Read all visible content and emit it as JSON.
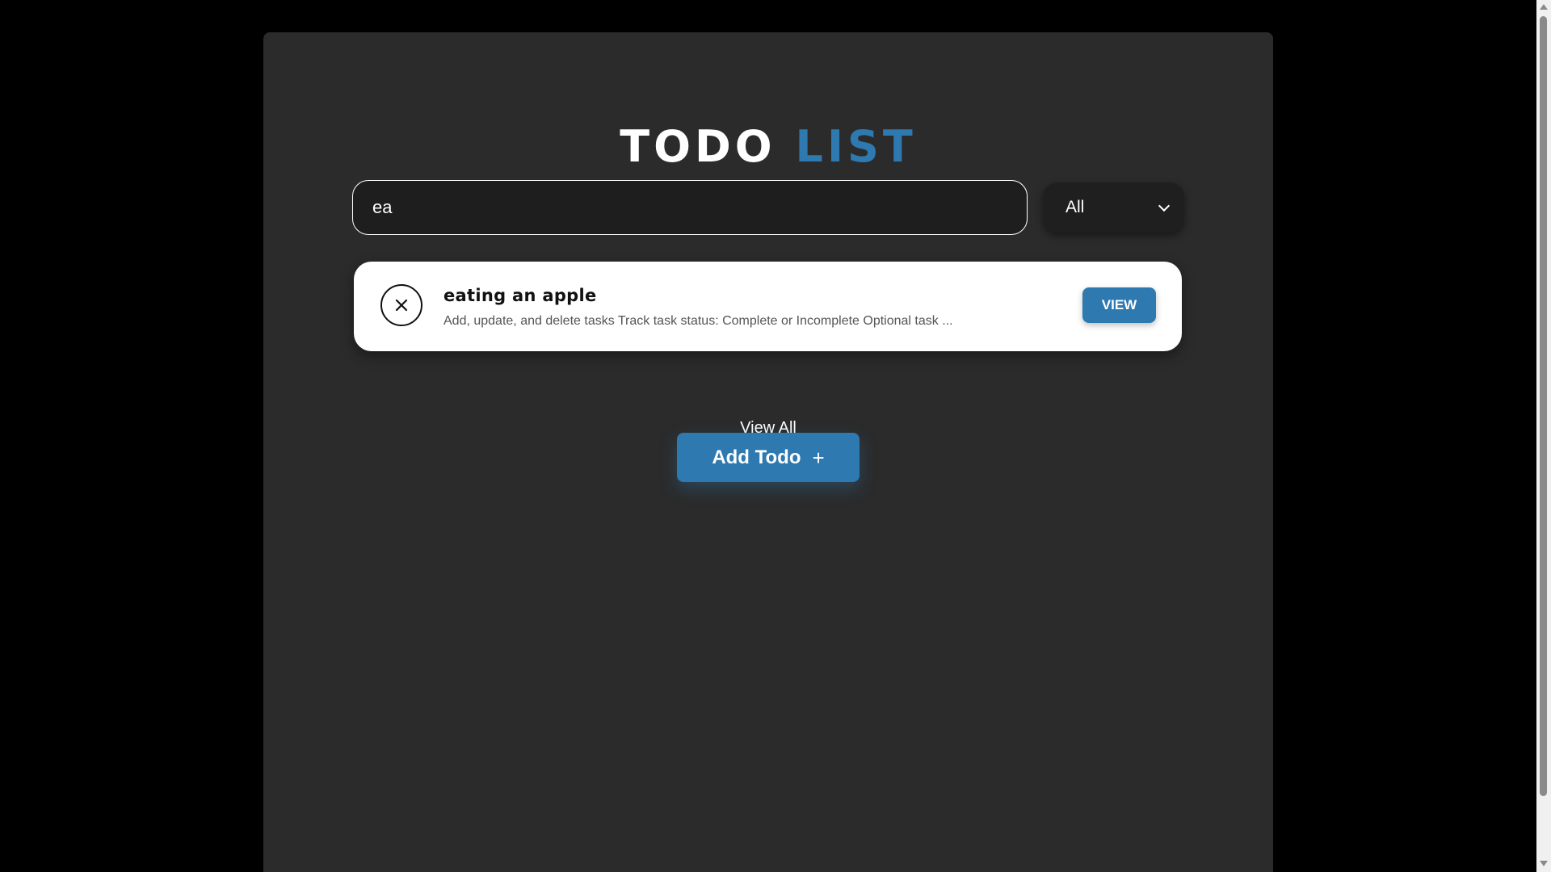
{
  "header": {
    "title_part1": "TODO",
    "title_part2": "LIST",
    "accent_color": "#2d79b0"
  },
  "search": {
    "value": "ea",
    "placeholder": ""
  },
  "filter": {
    "selected": "All"
  },
  "todos": [
    {
      "title": "eating an apple",
      "description": "Add, update, and delete tasks Track task status: Complete or Incomplete Optional task ...",
      "status_icon": "close-icon",
      "action_label": "VIEW"
    }
  ],
  "links": {
    "view_all": "View All"
  },
  "actions": {
    "add_todo_label": "Add Todo",
    "add_todo_icon": "+"
  }
}
